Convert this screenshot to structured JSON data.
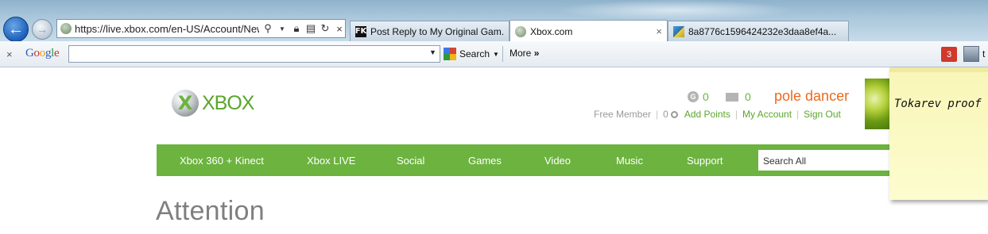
{
  "browser": {
    "address_url": "https://live.xbox.com/en-US/Account/NewT",
    "tabs": [
      {
        "label": "Post Reply to My Original Gam...",
        "icon": "fk-icon",
        "active": false
      },
      {
        "label": "Xbox.com",
        "icon": "xbox-favicon",
        "active": true
      },
      {
        "label": "8a8776c1596424232e3daa8ef4a...",
        "icon": "image-icon",
        "active": false
      }
    ],
    "tab_close_glyph": "×"
  },
  "toolbar": {
    "close_glyph": "×",
    "google_letters": [
      "G",
      "o",
      "o",
      "g",
      "l",
      "e"
    ],
    "search_value": "",
    "search_label": "Search",
    "more_label": "More",
    "notification_count": "3",
    "username_fragment": "t"
  },
  "xbox": {
    "logo_word": "XBOX",
    "g_count": "0",
    "message_count": "0",
    "gamertag": "pole dancer",
    "membership": "Free Member",
    "points": "0",
    "add_points": "Add Points",
    "my_account": "My Account",
    "sign_out": "Sign Out",
    "nav": [
      "Xbox 360 + Kinect",
      "Xbox LIVE",
      "Social",
      "Games",
      "Video",
      "Music",
      "Support"
    ],
    "search_placeholder": "Search All",
    "page_title": "Attention"
  },
  "sticky_note": {
    "text": "Tokarev proof"
  },
  "colors": {
    "xbox_green": "#6cb33f",
    "gamertag_orange": "#ea6a1f",
    "notification_red": "#d0392b",
    "sticky_yellow": "#fdfccf"
  }
}
